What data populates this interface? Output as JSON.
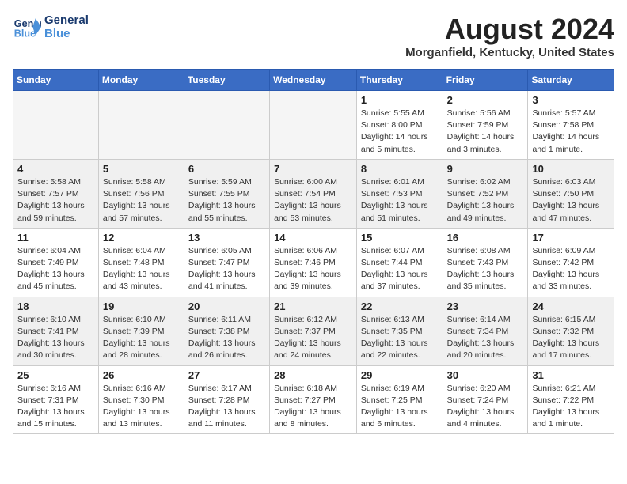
{
  "header": {
    "logo_line1": "General",
    "logo_line2": "Blue",
    "title": "August 2024",
    "subtitle": "Morganfield, Kentucky, United States"
  },
  "days_of_week": [
    "Sunday",
    "Monday",
    "Tuesday",
    "Wednesday",
    "Thursday",
    "Friday",
    "Saturday"
  ],
  "weeks": [
    [
      {
        "day": "",
        "empty": true
      },
      {
        "day": "",
        "empty": true
      },
      {
        "day": "",
        "empty": true
      },
      {
        "day": "",
        "empty": true
      },
      {
        "day": "1",
        "sunrise": "5:55 AM",
        "sunset": "8:00 PM",
        "daylight": "14 hours and 5 minutes."
      },
      {
        "day": "2",
        "sunrise": "5:56 AM",
        "sunset": "7:59 PM",
        "daylight": "14 hours and 3 minutes."
      },
      {
        "day": "3",
        "sunrise": "5:57 AM",
        "sunset": "7:58 PM",
        "daylight": "14 hours and 1 minute."
      }
    ],
    [
      {
        "day": "4",
        "sunrise": "5:58 AM",
        "sunset": "7:57 PM",
        "daylight": "13 hours and 59 minutes."
      },
      {
        "day": "5",
        "sunrise": "5:58 AM",
        "sunset": "7:56 PM",
        "daylight": "13 hours and 57 minutes."
      },
      {
        "day": "6",
        "sunrise": "5:59 AM",
        "sunset": "7:55 PM",
        "daylight": "13 hours and 55 minutes."
      },
      {
        "day": "7",
        "sunrise": "6:00 AM",
        "sunset": "7:54 PM",
        "daylight": "13 hours and 53 minutes."
      },
      {
        "day": "8",
        "sunrise": "6:01 AM",
        "sunset": "7:53 PM",
        "daylight": "13 hours and 51 minutes."
      },
      {
        "day": "9",
        "sunrise": "6:02 AM",
        "sunset": "7:52 PM",
        "daylight": "13 hours and 49 minutes."
      },
      {
        "day": "10",
        "sunrise": "6:03 AM",
        "sunset": "7:50 PM",
        "daylight": "13 hours and 47 minutes."
      }
    ],
    [
      {
        "day": "11",
        "sunrise": "6:04 AM",
        "sunset": "7:49 PM",
        "daylight": "13 hours and 45 minutes."
      },
      {
        "day": "12",
        "sunrise": "6:04 AM",
        "sunset": "7:48 PM",
        "daylight": "13 hours and 43 minutes."
      },
      {
        "day": "13",
        "sunrise": "6:05 AM",
        "sunset": "7:47 PM",
        "daylight": "13 hours and 41 minutes."
      },
      {
        "day": "14",
        "sunrise": "6:06 AM",
        "sunset": "7:46 PM",
        "daylight": "13 hours and 39 minutes."
      },
      {
        "day": "15",
        "sunrise": "6:07 AM",
        "sunset": "7:44 PM",
        "daylight": "13 hours and 37 minutes."
      },
      {
        "day": "16",
        "sunrise": "6:08 AM",
        "sunset": "7:43 PM",
        "daylight": "13 hours and 35 minutes."
      },
      {
        "day": "17",
        "sunrise": "6:09 AM",
        "sunset": "7:42 PM",
        "daylight": "13 hours and 33 minutes."
      }
    ],
    [
      {
        "day": "18",
        "sunrise": "6:10 AM",
        "sunset": "7:41 PM",
        "daylight": "13 hours and 30 minutes."
      },
      {
        "day": "19",
        "sunrise": "6:10 AM",
        "sunset": "7:39 PM",
        "daylight": "13 hours and 28 minutes."
      },
      {
        "day": "20",
        "sunrise": "6:11 AM",
        "sunset": "7:38 PM",
        "daylight": "13 hours and 26 minutes."
      },
      {
        "day": "21",
        "sunrise": "6:12 AM",
        "sunset": "7:37 PM",
        "daylight": "13 hours and 24 minutes."
      },
      {
        "day": "22",
        "sunrise": "6:13 AM",
        "sunset": "7:35 PM",
        "daylight": "13 hours and 22 minutes."
      },
      {
        "day": "23",
        "sunrise": "6:14 AM",
        "sunset": "7:34 PM",
        "daylight": "13 hours and 20 minutes."
      },
      {
        "day": "24",
        "sunrise": "6:15 AM",
        "sunset": "7:32 PM",
        "daylight": "13 hours and 17 minutes."
      }
    ],
    [
      {
        "day": "25",
        "sunrise": "6:16 AM",
        "sunset": "7:31 PM",
        "daylight": "13 hours and 15 minutes."
      },
      {
        "day": "26",
        "sunrise": "6:16 AM",
        "sunset": "7:30 PM",
        "daylight": "13 hours and 13 minutes."
      },
      {
        "day": "27",
        "sunrise": "6:17 AM",
        "sunset": "7:28 PM",
        "daylight": "13 hours and 11 minutes."
      },
      {
        "day": "28",
        "sunrise": "6:18 AM",
        "sunset": "7:27 PM",
        "daylight": "13 hours and 8 minutes."
      },
      {
        "day": "29",
        "sunrise": "6:19 AM",
        "sunset": "7:25 PM",
        "daylight": "13 hours and 6 minutes."
      },
      {
        "day": "30",
        "sunrise": "6:20 AM",
        "sunset": "7:24 PM",
        "daylight": "13 hours and 4 minutes."
      },
      {
        "day": "31",
        "sunrise": "6:21 AM",
        "sunset": "7:22 PM",
        "daylight": "13 hours and 1 minute."
      }
    ]
  ]
}
